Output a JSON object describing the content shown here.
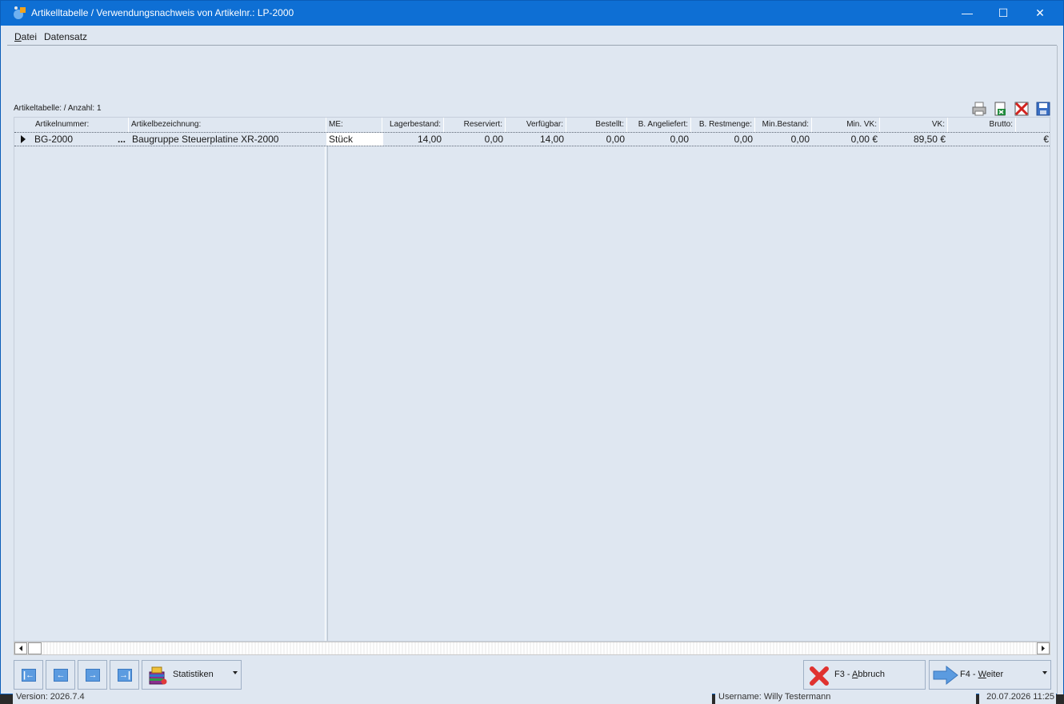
{
  "window": {
    "title": "Artikelltabelle / Verwendungsnachweis von Artikelnr.: LP-2000",
    "minimize": "—",
    "maximize": "☐",
    "close": "✕"
  },
  "menu": {
    "datei_first": "D",
    "datei_rest": "atei",
    "datensatz": "Datensatz"
  },
  "status_line": "Artikeltabelle: / Anzahl: 1",
  "toolbar_icons": [
    "printer-icon",
    "export-excel-icon",
    "delete-icon",
    "save-icon"
  ],
  "table": {
    "headers": {
      "artikelnummer": "Artikelnummer:",
      "bezeichnung": "Artikelbezeichnung:",
      "me": "ME:",
      "lagerbestand": "Lagerbestand:",
      "reserviert": "Reserviert:",
      "verfuegbar": "Verfügbar:",
      "bestellt": "Bestellt:",
      "angeliefert": "B. Angeliefert:",
      "restmenge": "B. Restmenge:",
      "minbestand": "Min.Bestand:",
      "minvk": "Min. VK:",
      "vk": "VK:",
      "brutto": "Brutto:"
    },
    "row": {
      "artikelnummer": "BG-2000",
      "ellipsis": "...",
      "bezeichnung": "Baugruppe Steuerplatine XR-2000",
      "me": "Stück",
      "lagerbestand": "14,00",
      "reserviert": "0,00",
      "verfuegbar": "14,00",
      "bestellt": "0,00",
      "angeliefert": "0,00",
      "restmenge": "0,00",
      "minbestand": "0,00",
      "minvk": "0,00 €",
      "vk": "89,50 €",
      "brutto": "€"
    }
  },
  "buttons": {
    "first": "|←",
    "prev": "←",
    "next": "→",
    "last": "→|",
    "statistiken": "Statistiken",
    "abbruch_prefix": "F3 - ",
    "abbruch_underlined": "A",
    "abbruch_rest": "bbruch",
    "weiter_prefix": "F4 - ",
    "weiter_underlined": "W",
    "weiter_rest": "eiter"
  },
  "statusbar": {
    "version": "Version: 2026.7.4",
    "user": "Username: Willy Testermann",
    "datetime": "20.07.2026 11:25"
  },
  "colors": {
    "titlebar": "#0e6fd4",
    "background": "#dfe7f1",
    "accent_arrow": "#5b9be0",
    "cancel_red": "#e0322f"
  }
}
